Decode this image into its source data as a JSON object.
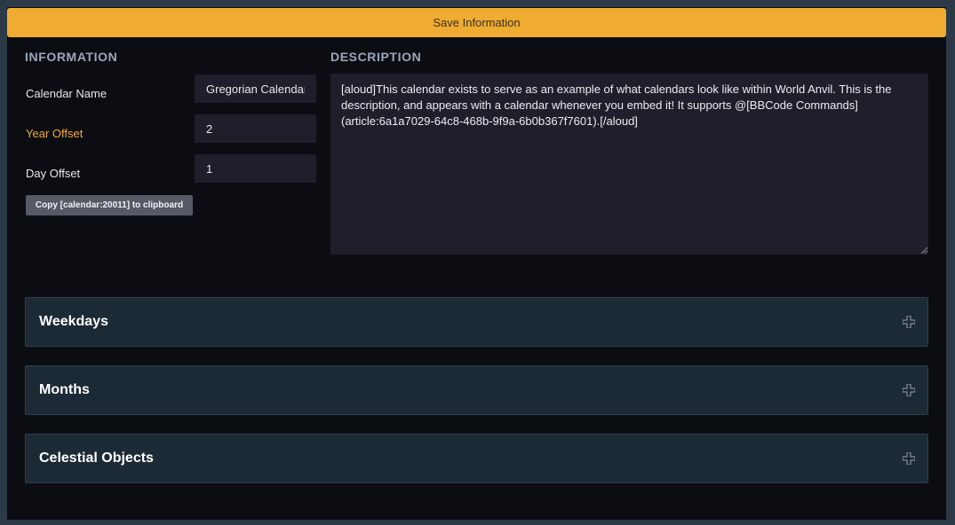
{
  "toolbar": {
    "save_label": "Save Information"
  },
  "information": {
    "title": "INFORMATION",
    "fields": [
      {
        "label": "Calendar Name",
        "value": "Gregorian Calendar",
        "accent": false
      },
      {
        "label": "Year Offset",
        "value": "2",
        "accent": true
      },
      {
        "label": "Day Offset",
        "value": "1",
        "accent": false
      }
    ],
    "copy_button": "Copy [calendar:20011] to clipboard"
  },
  "description": {
    "title": "DESCRIPTION",
    "text": "[aloud]This calendar exists to serve as an example of what calendars look like within World Anvil. This is the description, and appears with a calendar whenever you embed it! It supports @[BBCode Commands](article:6a1a7029-64c8-468b-9f9a-6b0b367f7601).[/aloud]"
  },
  "sections": [
    {
      "title": "Weekdays",
      "icon": "plus-icon"
    },
    {
      "title": "Months",
      "icon": "plus-icon"
    },
    {
      "title": "Celestial Objects",
      "icon": "plus-icon"
    }
  ],
  "colors": {
    "accent": "#f0ab32",
    "background": "#0c0d12",
    "panel": "#1c2a36",
    "input": "#1e1f2a"
  }
}
